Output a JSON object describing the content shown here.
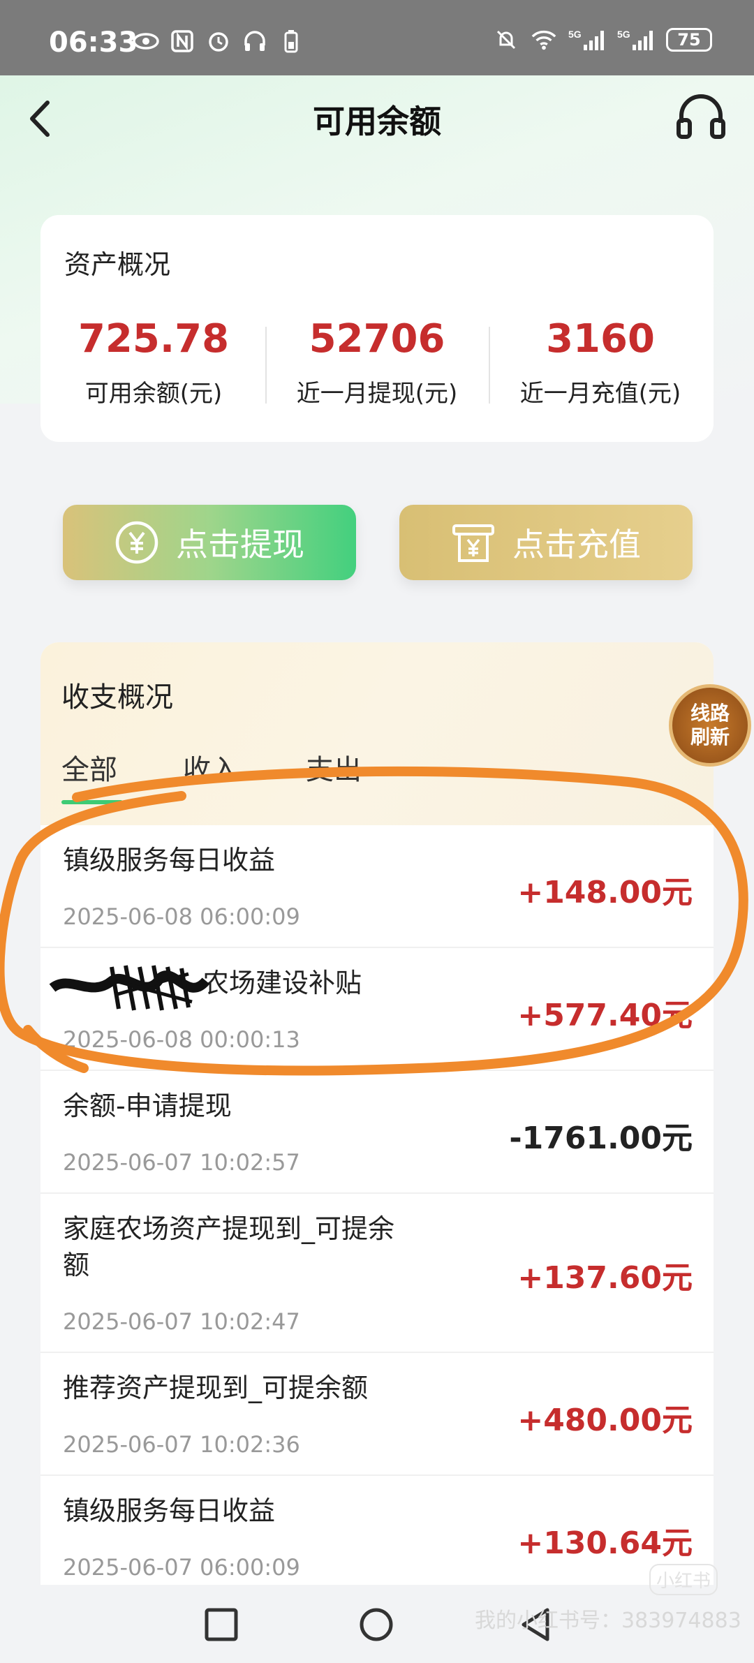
{
  "status_bar": {
    "time": "06:33",
    "battery": "75",
    "left_icons": [
      "eye-icon",
      "nfc-icon",
      "alarm-icon",
      "headphones-icon",
      "battery-saver-icon"
    ],
    "right_icons": [
      "mute-icon",
      "wifi-icon",
      "5g-signal-icon",
      "5g-signal-icon"
    ]
  },
  "header": {
    "title": "可用余额"
  },
  "assets": {
    "title": "资产概况",
    "stats": [
      {
        "value": "725.78",
        "label": "可用余额(元)"
      },
      {
        "value": "52706",
        "label": "近一月提现(元)"
      },
      {
        "value": "3160",
        "label": "近一月充值(元)"
      }
    ]
  },
  "actions": {
    "withdraw_label": "点击提现",
    "recharge_label": "点击充值"
  },
  "transactions": {
    "title": "收支概况",
    "tabs": [
      "全部",
      "收入",
      "支出"
    ],
    "rows": [
      {
        "name": "镇级服务每日收益",
        "time": "2025-06-08 06:00:09",
        "amount": "+148.00元",
        "sign": "pos"
      },
      {
        "name": "农场建设补贴",
        "time": "2025-06-08 00:00:13",
        "amount": "+577.40元",
        "sign": "pos"
      },
      {
        "name": "余额-申请提现",
        "time": "2025-06-07 10:02:57",
        "amount": "-1761.00元",
        "sign": "neg"
      },
      {
        "name": "家庭农场资产提现到_可提余额",
        "time": "2025-06-07 10:02:47",
        "amount": "+137.60元",
        "sign": "pos"
      },
      {
        "name": "推荐资产提现到_可提余额",
        "time": "2025-06-07 10:02:36",
        "amount": "+480.00元",
        "sign": "pos"
      },
      {
        "name": "镇级服务每日收益",
        "time": "2025-06-07 06:00:09",
        "amount": "+130.64元",
        "sign": "pos"
      }
    ]
  },
  "refresh_badge": {
    "line1": "线路",
    "line2": "刷新"
  },
  "watermark": {
    "text": "我的小红书号：383974883",
    "logo": "小红书"
  },
  "colors": {
    "accent_green": "#3ecb74",
    "amount_red": "#c62d2d",
    "annotation_orange": "#f08a2c"
  }
}
